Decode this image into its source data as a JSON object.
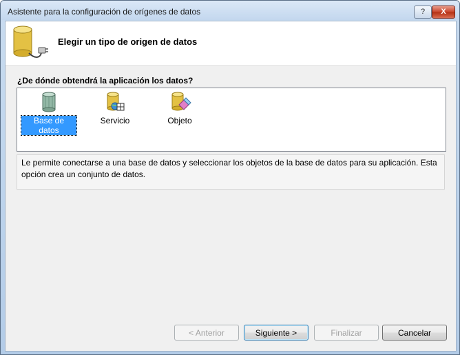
{
  "window": {
    "title": "Asistente para la configuración de orígenes de datos",
    "help_button": "?",
    "close_button": "X"
  },
  "header": {
    "title": "Elegir un tipo de origen de datos",
    "icon": "database-plug-icon"
  },
  "question": "¿De dónde obtendrá la aplicación los datos?",
  "choices": [
    {
      "label": "Base de datos",
      "icon": "database-icon",
      "selected": true
    },
    {
      "label": "Servicio",
      "icon": "service-icon",
      "selected": false
    },
    {
      "label": "Objeto",
      "icon": "object-icon",
      "selected": false
    }
  ],
  "description": "Le permite conectarse a una base de datos y seleccionar los objetos de la base de datos para su aplicación. Esta opción crea un conjunto de datos.",
  "buttons": {
    "previous": "< Anterior",
    "next": "Siguiente >",
    "finish": "Finalizar",
    "cancel": "Cancelar"
  },
  "colors": {
    "selection": "#3399ff",
    "client_background": "#f0f0f0",
    "window_frame": "#b3cce8"
  }
}
